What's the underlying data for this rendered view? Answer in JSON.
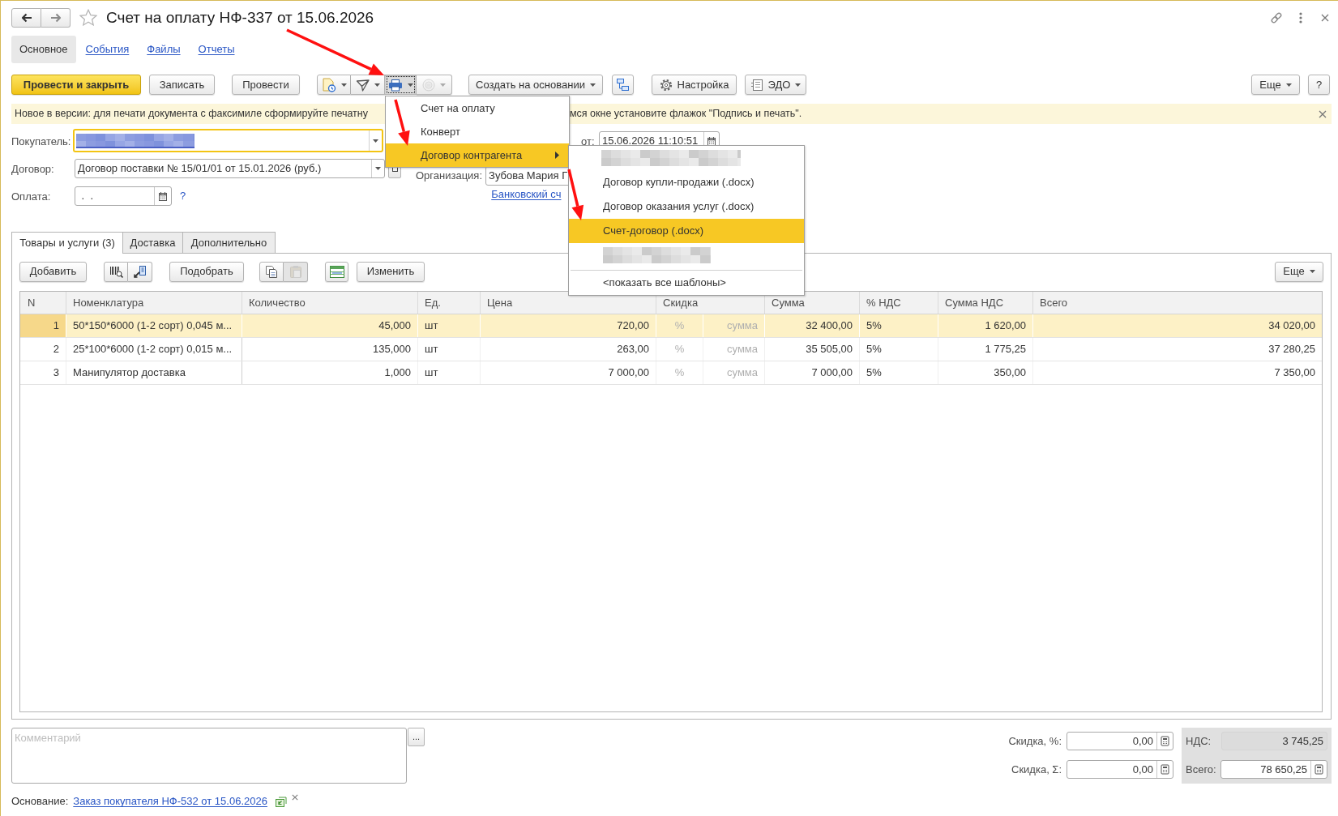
{
  "window": {
    "title": "Счет на оплату НФ-337 от 15.06.2026",
    "favorite": false
  },
  "nav_tabs": [
    {
      "label": "Основное",
      "selected": true
    },
    {
      "label": "События",
      "selected": false
    },
    {
      "label": "Файлы",
      "selected": false
    },
    {
      "label": "Отчеты",
      "selected": false
    }
  ],
  "toolbar": {
    "post_and_close": "Провести и закрыть",
    "save": "Записать",
    "post": "Провести",
    "icon_group": [
      {
        "pressed": false,
        "disabled": false
      },
      {
        "pressed": false,
        "disabled": false
      },
      {
        "pressed": true,
        "disabled": false
      },
      {
        "pressed": false,
        "disabled": true
      }
    ],
    "create_based_on": "Создать на основании",
    "settings": "Настройка",
    "edo": "ЭДО",
    "more": "Еще",
    "help": "?"
  },
  "info_bar": {
    "text_start": "Новое в версии: для печати документа с факсимиле сформируйте печатну",
    "text_end": "мся окне установите флажок \"Подпись и печать\"."
  },
  "fields": {
    "buyer": {
      "label": "Покупатель:",
      "focused": true
    },
    "date": {
      "label": "от:",
      "value": "15.06.2026 11:10:51"
    },
    "contract": {
      "label": "Договор:",
      "value": "Договор поставки № 15/01/01 от 15.01.2026 (руб.)"
    },
    "organization": {
      "label": "Организация:",
      "value": "Зубова Мария Г"
    },
    "payment": {
      "label": "Оплата:",
      "value": " .  ."
    },
    "payment_help": "?",
    "bank_account": "Банковский сч"
  },
  "print_menu": {
    "items": [
      {
        "label": "Счет на оплату",
        "selected": false,
        "submenu": false
      },
      {
        "label": "Конверт",
        "selected": false,
        "submenu": false
      },
      {
        "label": "Договор контрагента",
        "selected": true,
        "submenu": true
      }
    ]
  },
  "template_menu": {
    "items": [
      {
        "kind": "redacted",
        "selected": false
      },
      {
        "kind": "template",
        "label": "Договор купли-продажи (.docx)",
        "selected": false
      },
      {
        "kind": "template",
        "label": "Договор оказания услуг (.docx)",
        "selected": false
      },
      {
        "kind": "template",
        "label": "Счет-договор (.docx)",
        "selected": true
      },
      {
        "kind": "redacted",
        "selected": false
      }
    ],
    "show_all": "<показать все шаблоны>"
  },
  "tabs": [
    {
      "label": "Товары и услуги (3)",
      "selected": true
    },
    {
      "label": "Доставка",
      "selected": false
    },
    {
      "label": "Дополнительно",
      "selected": false
    }
  ],
  "goods_toolbar": {
    "add": "Добавить",
    "scan_buttons": [
      {
        "disabled": false
      },
      {
        "disabled": false
      }
    ],
    "pick": "Подобрать",
    "clipboard_buttons": [
      {
        "disabled": false
      },
      {
        "disabled": true
      }
    ],
    "table_button": {
      "disabled": false
    },
    "change": "Изменить",
    "more": "Еще"
  },
  "table": {
    "columns": [
      "N",
      "Номенклатура",
      "Количество",
      "Ед.",
      "Цена",
      "Скидка",
      "Сумма",
      "% НДС",
      "Сумма НДС",
      "Всего"
    ],
    "rows": [
      {
        "selected": true,
        "n": "1",
        "item": "50*150*6000 (1-2 сорт) 0,045 м...",
        "quantity": "45,000",
        "unit": "шт",
        "price": "720,00",
        "discount_percent": "%",
        "discount_sum": "сумма",
        "sum": "32 400,00",
        "vat_rate": "5%",
        "vat": "1 620,00",
        "total": "34 020,00"
      },
      {
        "selected": false,
        "n": "2",
        "item": "25*100*6000 (1-2 сорт) 0,015 м...",
        "quantity": "135,000",
        "unit": "шт",
        "price": "263,00",
        "discount_percent": "%",
        "discount_sum": "сумма",
        "sum": "35 505,00",
        "vat_rate": "5%",
        "vat": "1 775,25",
        "total": "37 280,25"
      },
      {
        "selected": false,
        "n": "3",
        "item": "Манипулятор доставка",
        "quantity": "1,000",
        "unit": "шт",
        "price": "7 000,00",
        "discount_percent": "%",
        "discount_sum": "сумма",
        "sum": "7 000,00",
        "vat_rate": "5%",
        "vat": "350,00",
        "total": "7 350,00"
      }
    ]
  },
  "comment": {
    "placeholder": "Комментарий",
    "expand": "..."
  },
  "totals": {
    "discount_percent": {
      "label": "Скидка, %:",
      "value": "0,00"
    },
    "discount_sum": {
      "label": "Скидка, Σ:",
      "value": "0,00"
    },
    "vat": {
      "label": "НДС:",
      "value": "3 745,25"
    },
    "total": {
      "label": "Всего:",
      "value": "78 650,25"
    }
  },
  "basis": {
    "label": "Основание:",
    "link": "Заказ покупателя НФ-532 от 15.06.2026"
  }
}
